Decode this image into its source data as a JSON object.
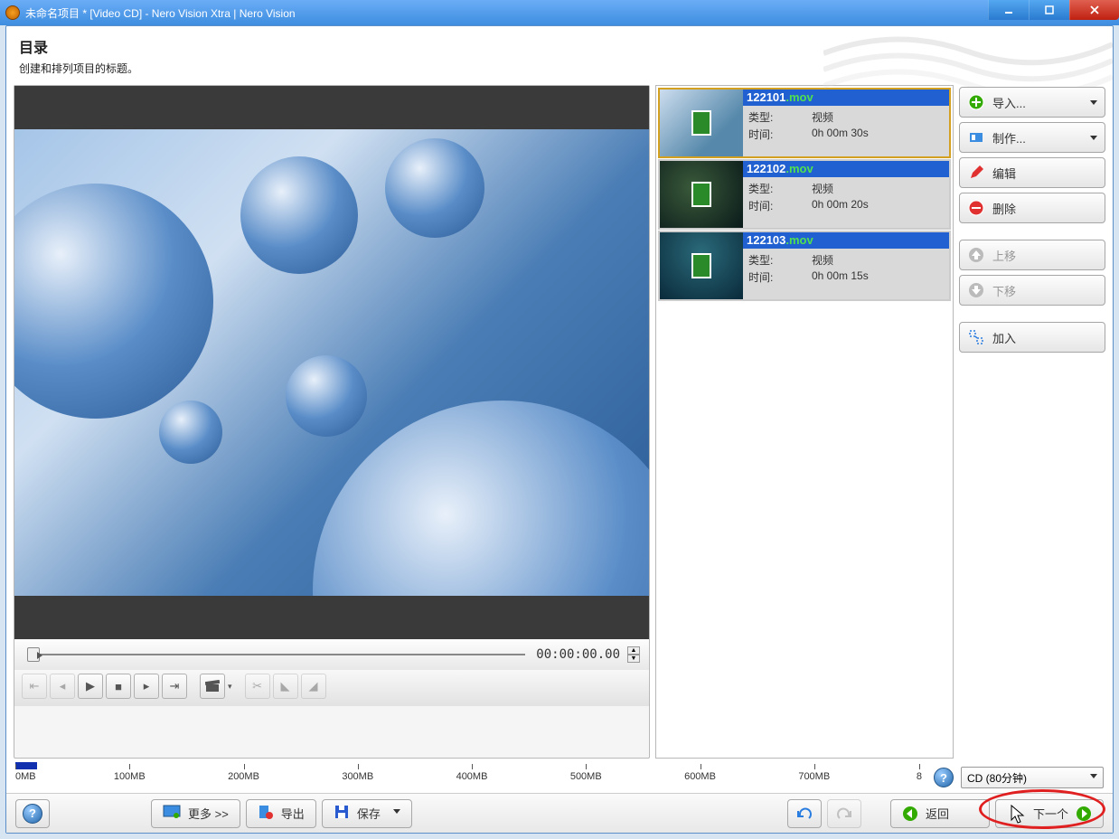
{
  "window": {
    "title": "未命名项目 * [Video CD] - Nero Vision Xtra | Nero Vision"
  },
  "header": {
    "title": "目录",
    "subtitle": "创建和排列项目的标题。"
  },
  "preview": {
    "timecode": "00:00:00.00"
  },
  "assets": [
    {
      "name": "122101",
      "ext": ".mov",
      "type_label": "类型:",
      "type_value": "视频",
      "time_label": "时间:",
      "time_value": "0h 00m 30s",
      "selected": true
    },
    {
      "name": "122102",
      "ext": ".mov",
      "type_label": "类型:",
      "type_value": "视频",
      "time_label": "时间:",
      "time_value": "0h 00m 20s",
      "selected": false
    },
    {
      "name": "122103",
      "ext": ".mov",
      "type_label": "类型:",
      "type_value": "视频",
      "time_label": "时间:",
      "time_value": "0h 00m 15s",
      "selected": false
    }
  ],
  "side": {
    "import": "导入...",
    "make": "制作...",
    "edit": "编辑",
    "delete": "删除",
    "move_up": "上移",
    "move_down": "下移",
    "join": "加入"
  },
  "ruler": {
    "labels": [
      "0MB",
      "100MB",
      "200MB",
      "300MB",
      "400MB",
      "500MB",
      "600MB",
      "700MB",
      "8"
    ]
  },
  "media_select": "CD (80分钟)",
  "bottom": {
    "more": "更多 >>",
    "export": "导出",
    "save": "保存",
    "back": "返回",
    "next": "下一个"
  }
}
